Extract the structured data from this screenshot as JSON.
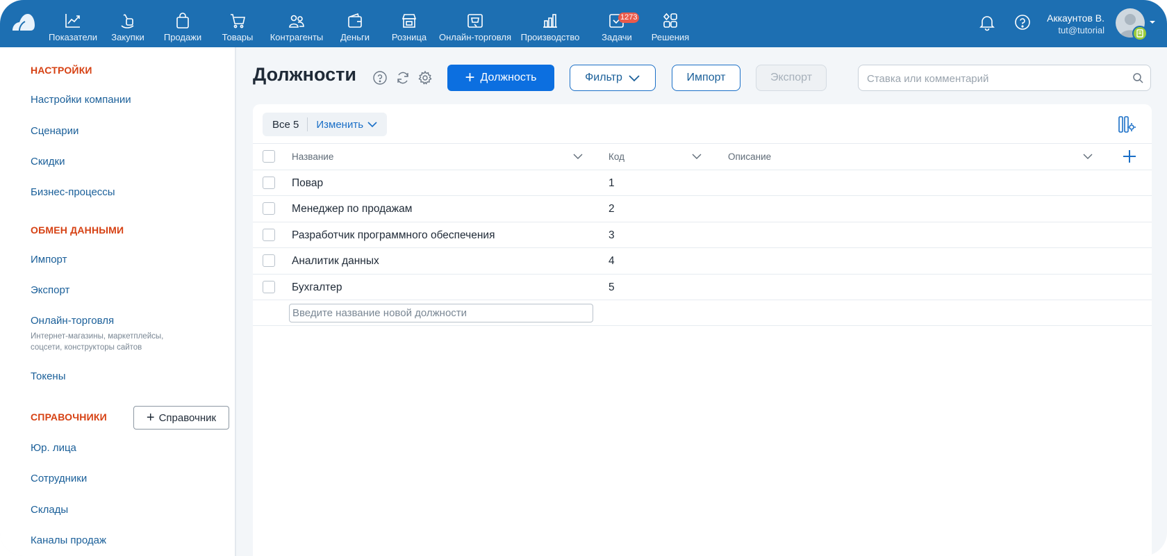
{
  "nav": {
    "items": [
      {
        "label": "Показатели",
        "icon": "chart-line-icon"
      },
      {
        "label": "Закупки",
        "icon": "hand-bag-icon"
      },
      {
        "label": "Продажи",
        "icon": "shopping-bag-icon"
      },
      {
        "label": "Товары",
        "icon": "cart-icon"
      },
      {
        "label": "Контрагенты",
        "icon": "people-icon"
      },
      {
        "label": "Деньги",
        "icon": "wallet-icon"
      },
      {
        "label": "Розница",
        "icon": "store-icon"
      },
      {
        "label": "Онлайн-торговля",
        "icon": "online-store-icon"
      },
      {
        "label": "Производство",
        "icon": "factory-icon"
      },
      {
        "label": "Задачи",
        "icon": "tasks-check-icon",
        "badge": "1273"
      },
      {
        "label": "Решения",
        "icon": "apps-grid-icon"
      }
    ]
  },
  "user": {
    "name": "Аккаунтов В.",
    "email": "tut@tutorial"
  },
  "sidebar": {
    "settings_title": "НАСТРОЙКИ",
    "settings_items": [
      "Настройки компании",
      "Сценарии",
      "Скидки",
      "Бизнес-процессы"
    ],
    "exchange_title": "ОБМЕН ДАННЫМИ",
    "exchange_items": [
      "Импорт",
      "Экспорт",
      "Онлайн-торговля"
    ],
    "online_sub": "Интернет-магазины, маркетплейсы, соцсети, конструкторы сайтов",
    "tokens": "Токены",
    "directories_title": "СПРАВОЧНИКИ",
    "add_directory": "Справочник",
    "directory_items": [
      "Юр. лица",
      "Сотрудники",
      "Склады",
      "Каналы продаж"
    ]
  },
  "toolbar": {
    "title": "Должности",
    "add_label": "Должность",
    "filter_label": "Фильтр",
    "import_label": "Импорт",
    "export_label": "Экспорт",
    "search_placeholder": "Ставка или комментарий"
  },
  "filter": {
    "all_label": "Все 5",
    "edit_label": "Изменить"
  },
  "table": {
    "columns": [
      "Название",
      "Код",
      "Описание"
    ],
    "rows": [
      {
        "name": "Повар",
        "code": "1",
        "desc": ""
      },
      {
        "name": "Менеджер по продажам",
        "code": "2",
        "desc": ""
      },
      {
        "name": "Разработчик программного обеспечения",
        "code": "3",
        "desc": ""
      },
      {
        "name": "Аналитик данных",
        "code": "4",
        "desc": ""
      },
      {
        "name": "Бухгалтер",
        "code": "5",
        "desc": ""
      }
    ],
    "new_row_placeholder": "Введите название новой должности"
  },
  "colors": {
    "topbar": "#1d6fb2",
    "primary": "#0c6fe0",
    "section": "#d64113",
    "link": "#1a5f99",
    "badge": "#ea5a4b"
  }
}
